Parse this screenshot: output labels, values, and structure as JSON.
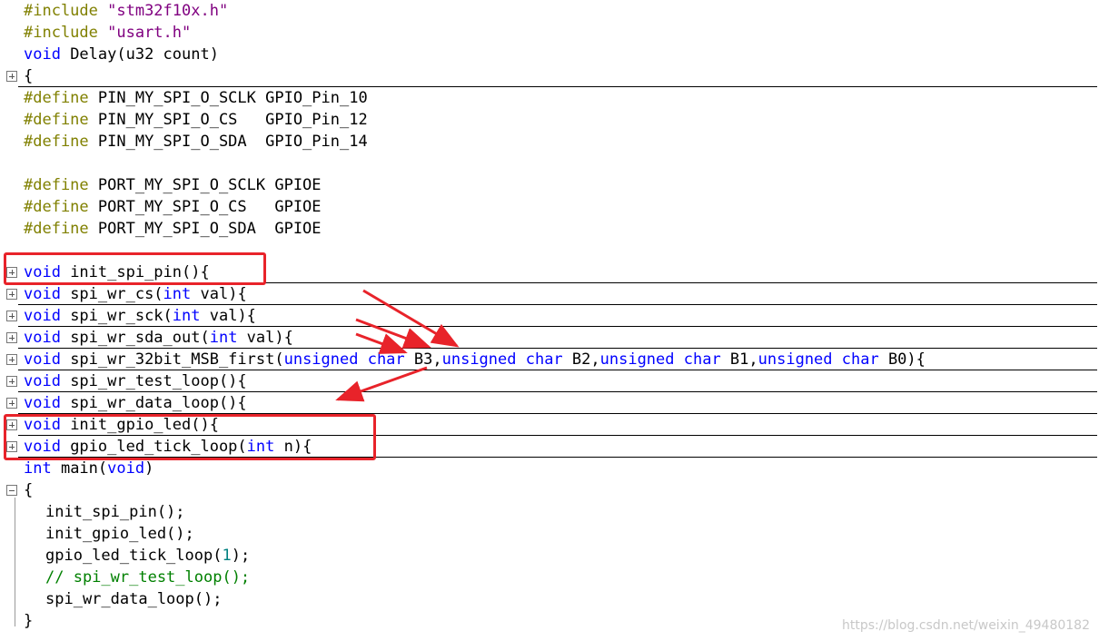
{
  "editor": {
    "lines": [
      {
        "kind": "include",
        "tokens": [
          {
            "t": "#include ",
            "c": "pp"
          },
          {
            "t": "\"stm32f10x.h\"",
            "c": "str"
          }
        ]
      },
      {
        "kind": "include",
        "tokens": [
          {
            "t": "#include ",
            "c": "pp"
          },
          {
            "t": "\"usart.h\"",
            "c": "str"
          }
        ]
      },
      {
        "kind": "code",
        "tokens": [
          {
            "t": "void",
            "c": "kw"
          },
          {
            "t": " Delay(u32 count)",
            "c": ""
          }
        ]
      },
      {
        "kind": "fold",
        "tokens": [
          {
            "t": "{",
            "c": ""
          }
        ]
      },
      {
        "kind": "define",
        "tokens": [
          {
            "t": "#define",
            "c": "pp"
          },
          {
            "t": " PIN_MY_SPI_O_SCLK GPIO_Pin_10",
            "c": ""
          }
        ]
      },
      {
        "kind": "define",
        "tokens": [
          {
            "t": "#define",
            "c": "pp"
          },
          {
            "t": " PIN_MY_SPI_O_CS   GPIO_Pin_12",
            "c": ""
          }
        ]
      },
      {
        "kind": "define",
        "tokens": [
          {
            "t": "#define",
            "c": "pp"
          },
          {
            "t": " PIN_MY_SPI_O_SDA  GPIO_Pin_14",
            "c": ""
          }
        ]
      },
      {
        "kind": "blank",
        "tokens": []
      },
      {
        "kind": "define",
        "tokens": [
          {
            "t": "#define",
            "c": "pp"
          },
          {
            "t": " PORT_MY_SPI_O_SCLK GPIOE",
            "c": ""
          }
        ]
      },
      {
        "kind": "define",
        "tokens": [
          {
            "t": "#define",
            "c": "pp"
          },
          {
            "t": " PORT_MY_SPI_O_CS   GPIOE",
            "c": ""
          }
        ]
      },
      {
        "kind": "define",
        "tokens": [
          {
            "t": "#define",
            "c": "pp"
          },
          {
            "t": " PORT_MY_SPI_O_SDA  GPIOE",
            "c": ""
          }
        ]
      },
      {
        "kind": "blank",
        "tokens": []
      },
      {
        "kind": "fold",
        "tokens": [
          {
            "t": "void",
            "c": "kw"
          },
          {
            "t": " init_spi_pin(){",
            "c": ""
          }
        ]
      },
      {
        "kind": "fold",
        "tokens": [
          {
            "t": "void",
            "c": "kw"
          },
          {
            "t": " spi_wr_cs(",
            "c": ""
          },
          {
            "t": "int",
            "c": "kw"
          },
          {
            "t": " val){",
            "c": ""
          }
        ]
      },
      {
        "kind": "fold",
        "tokens": [
          {
            "t": "void",
            "c": "kw"
          },
          {
            "t": " spi_wr_sck(",
            "c": ""
          },
          {
            "t": "int",
            "c": "kw"
          },
          {
            "t": " val){",
            "c": ""
          }
        ]
      },
      {
        "kind": "fold",
        "tokens": [
          {
            "t": "void",
            "c": "kw"
          },
          {
            "t": " spi_wr_sda_out(",
            "c": ""
          },
          {
            "t": "int",
            "c": "kw"
          },
          {
            "t": " val){",
            "c": ""
          }
        ]
      },
      {
        "kind": "fold",
        "tokens": [
          {
            "t": "void",
            "c": "kw"
          },
          {
            "t": " spi_wr_32bit_MSB_first(",
            "c": ""
          },
          {
            "t": "unsigned char",
            "c": "kw"
          },
          {
            "t": " B3,",
            "c": ""
          },
          {
            "t": "unsigned char",
            "c": "kw"
          },
          {
            "t": " B2,",
            "c": ""
          },
          {
            "t": "unsigned char",
            "c": "kw"
          },
          {
            "t": " B1,",
            "c": ""
          },
          {
            "t": "unsigned char",
            "c": "kw"
          },
          {
            "t": " B0){",
            "c": ""
          }
        ]
      },
      {
        "kind": "fold",
        "tokens": [
          {
            "t": "void",
            "c": "kw"
          },
          {
            "t": " spi_wr_test_loop(){",
            "c": ""
          }
        ]
      },
      {
        "kind": "fold",
        "tokens": [
          {
            "t": "void",
            "c": "kw"
          },
          {
            "t": " spi_wr_data_loop(){",
            "c": ""
          }
        ]
      },
      {
        "kind": "fold",
        "tokens": [
          {
            "t": "void",
            "c": "kw"
          },
          {
            "t": " init_gpio_led(){",
            "c": ""
          }
        ]
      },
      {
        "kind": "fold",
        "tokens": [
          {
            "t": "void",
            "c": "kw"
          },
          {
            "t": " gpio_led_tick_loop(",
            "c": ""
          },
          {
            "t": "int",
            "c": "kw"
          },
          {
            "t": " n){",
            "c": ""
          }
        ]
      },
      {
        "kind": "code",
        "tokens": [
          {
            "t": "int",
            "c": "kw"
          },
          {
            "t": " main(",
            "c": ""
          },
          {
            "t": "void",
            "c": "kw"
          },
          {
            "t": ")",
            "c": ""
          }
        ]
      },
      {
        "kind": "open",
        "tokens": [
          {
            "t": "{",
            "c": ""
          }
        ]
      },
      {
        "kind": "inner",
        "tokens": [
          {
            "t": "init_spi_pin();",
            "c": ""
          }
        ]
      },
      {
        "kind": "inner",
        "tokens": [
          {
            "t": "init_gpio_led();",
            "c": ""
          }
        ]
      },
      {
        "kind": "inner",
        "tokens": [
          {
            "t": "gpio_led_tick_loop(",
            "c": ""
          },
          {
            "t": "1",
            "c": "num"
          },
          {
            "t": ");",
            "c": ""
          }
        ]
      },
      {
        "kind": "inner",
        "tokens": [
          {
            "t": "// spi_wr_test_loop();",
            "c": "cm"
          }
        ]
      },
      {
        "kind": "inner",
        "tokens": [
          {
            "t": "spi_wr_data_loop();",
            "c": ""
          }
        ]
      },
      {
        "kind": "close",
        "tokens": [
          {
            "t": "}",
            "c": ""
          }
        ]
      }
    ]
  },
  "colors": {
    "keyword": "#0000ff",
    "preprocessor": "#808000",
    "string": "#800080",
    "number": "#008080",
    "comment": "#008000",
    "highlight": "#e8232a"
  },
  "watermark": "https://blog.csdn.net/weixin_49480182"
}
